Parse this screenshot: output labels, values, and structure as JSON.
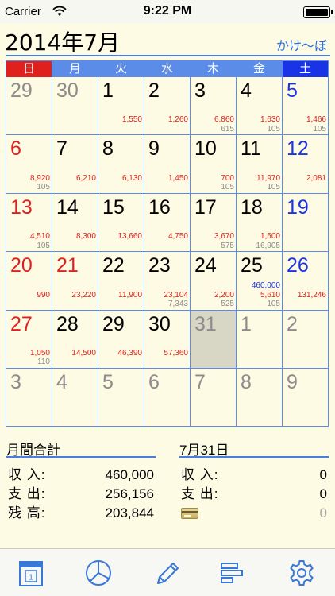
{
  "status_bar": {
    "carrier": "Carrier",
    "time": "9:22 PM"
  },
  "header": {
    "title": "2014年7月",
    "app_link": "かけ〜ぼ"
  },
  "weekdays": [
    {
      "label": "日",
      "style": "sun"
    },
    {
      "label": "月",
      "style": "mid"
    },
    {
      "label": "火",
      "style": "mid"
    },
    {
      "label": "水",
      "style": "mid"
    },
    {
      "label": "木",
      "style": "mid"
    },
    {
      "label": "金",
      "style": "mid"
    },
    {
      "label": "土",
      "style": "sat"
    }
  ],
  "weeks": [
    [
      {
        "day": "29",
        "color": "gray",
        "income": "",
        "expense": "",
        "card": ""
      },
      {
        "day": "30",
        "color": "gray",
        "income": "",
        "expense": "",
        "card": ""
      },
      {
        "day": "1",
        "color": "black",
        "income": "",
        "expense": "1,550",
        "card": ""
      },
      {
        "day": "2",
        "color": "black",
        "income": "",
        "expense": "1,260",
        "card": ""
      },
      {
        "day": "3",
        "color": "black",
        "income": "",
        "expense": "6,860",
        "card": "615"
      },
      {
        "day": "4",
        "color": "black",
        "income": "",
        "expense": "1,630",
        "card": "105"
      },
      {
        "day": "5",
        "color": "blue",
        "income": "",
        "expense": "1,466",
        "card": "105"
      }
    ],
    [
      {
        "day": "6",
        "color": "red",
        "income": "",
        "expense": "8,920",
        "card": "105"
      },
      {
        "day": "7",
        "color": "black",
        "income": "",
        "expense": "6,210",
        "card": ""
      },
      {
        "day": "8",
        "color": "black",
        "income": "",
        "expense": "6,130",
        "card": ""
      },
      {
        "day": "9",
        "color": "black",
        "income": "",
        "expense": "1,450",
        "card": ""
      },
      {
        "day": "10",
        "color": "black",
        "income": "",
        "expense": "700",
        "card": "105"
      },
      {
        "day": "11",
        "color": "black",
        "income": "",
        "expense": "11,970",
        "card": "105"
      },
      {
        "day": "12",
        "color": "blue",
        "income": "",
        "expense": "2,081",
        "card": ""
      }
    ],
    [
      {
        "day": "13",
        "color": "red",
        "income": "",
        "expense": "4,510",
        "card": "105"
      },
      {
        "day": "14",
        "color": "black",
        "income": "",
        "expense": "8,300",
        "card": ""
      },
      {
        "day": "15",
        "color": "black",
        "income": "",
        "expense": "13,660",
        "card": ""
      },
      {
        "day": "16",
        "color": "black",
        "income": "",
        "expense": "4,750",
        "card": ""
      },
      {
        "day": "17",
        "color": "black",
        "income": "",
        "expense": "3,670",
        "card": "575"
      },
      {
        "day": "18",
        "color": "black",
        "income": "",
        "expense": "1,500",
        "card": "16,905"
      },
      {
        "day": "19",
        "color": "blue",
        "income": "",
        "expense": "",
        "card": ""
      }
    ],
    [
      {
        "day": "20",
        "color": "red",
        "income": "",
        "expense": "990",
        "card": ""
      },
      {
        "day": "21",
        "color": "red",
        "income": "",
        "expense": "23,220",
        "card": ""
      },
      {
        "day": "22",
        "color": "black",
        "income": "",
        "expense": "11,900",
        "card": ""
      },
      {
        "day": "23",
        "color": "black",
        "income": "",
        "expense": "23,104",
        "card": "7,343"
      },
      {
        "day": "24",
        "color": "black",
        "income": "",
        "expense": "2,200",
        "card": "525"
      },
      {
        "day": "25",
        "color": "black",
        "income": "460,000",
        "expense": "5,610",
        "card": "105"
      },
      {
        "day": "26",
        "color": "blue",
        "income": "",
        "expense": "131,246",
        "card": ""
      }
    ],
    [
      {
        "day": "27",
        "color": "red",
        "income": "",
        "expense": "1,050",
        "card": "110"
      },
      {
        "day": "28",
        "color": "black",
        "income": "",
        "expense": "14,500",
        "card": ""
      },
      {
        "day": "29",
        "color": "black",
        "income": "",
        "expense": "46,390",
        "card": ""
      },
      {
        "day": "30",
        "color": "black",
        "income": "",
        "expense": "57,360",
        "card": ""
      },
      {
        "day": "31",
        "color": "gray",
        "today": true,
        "income": "",
        "expense": "",
        "card": ""
      },
      {
        "day": "1",
        "color": "gray",
        "income": "",
        "expense": "",
        "card": ""
      },
      {
        "day": "2",
        "color": "gray",
        "income": "",
        "expense": "",
        "card": ""
      }
    ],
    [
      {
        "day": "3",
        "color": "gray",
        "income": "",
        "expense": "",
        "card": ""
      },
      {
        "day": "4",
        "color": "gray",
        "income": "",
        "expense": "",
        "card": ""
      },
      {
        "day": "5",
        "color": "gray",
        "income": "",
        "expense": "",
        "card": ""
      },
      {
        "day": "6",
        "color": "gray",
        "income": "",
        "expense": "",
        "card": ""
      },
      {
        "day": "7",
        "color": "gray",
        "income": "",
        "expense": "",
        "card": ""
      },
      {
        "day": "8",
        "color": "gray",
        "income": "",
        "expense": "",
        "card": ""
      },
      {
        "day": "9",
        "color": "gray",
        "income": "",
        "expense": "",
        "card": ""
      }
    ]
  ],
  "month_summary": {
    "heading": "月間合計",
    "income_label": "収 入:",
    "income_value": "460,000",
    "expense_label": "支 出:",
    "expense_value": "256,156",
    "balance_label": "残 高:",
    "balance_value": "203,844"
  },
  "day_summary": {
    "heading": "7月31日",
    "income_label": "収 入:",
    "income_value": "0",
    "expense_label": "支 出:",
    "expense_value": "0",
    "card_value": "0"
  },
  "tabbar": {
    "icons": [
      "calendar-icon",
      "pie-chart-icon",
      "pencil-icon",
      "bar-list-icon",
      "gear-icon"
    ]
  },
  "colors": {
    "accent_blue": "#4a7de0",
    "sunday_red": "#e0201c",
    "saturday_blue": "#1933e6",
    "background": "#fdfbe3"
  }
}
